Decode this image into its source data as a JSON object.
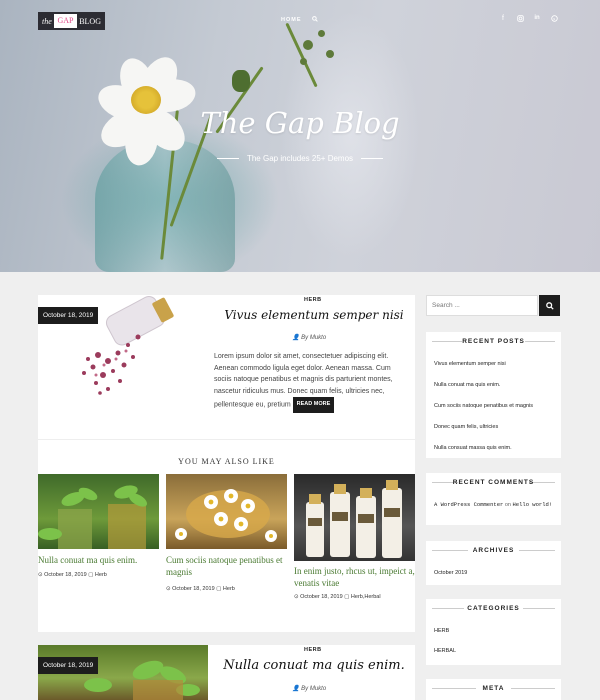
{
  "header": {
    "logo": {
      "the": "the",
      "gap": "GAP",
      "blog": "BLOG"
    },
    "nav": {
      "home": "HOME",
      "search_icon": "search-icon"
    },
    "social_icons": [
      "facebook-icon",
      "instagram-icon",
      "linkedin-icon",
      "skype-icon"
    ],
    "hero_title": "The Gap Blog",
    "hero_subtitle": "The Gap includes 25+ Demos"
  },
  "featured_post": {
    "date": "October 18, 2019",
    "category": "HERB",
    "title": "Vivus elementum semper nisi",
    "author": "By Mukto",
    "excerpt": "Lorem ipsum dolor sit amet, consectetuer adipiscing elit. Aenean commodo ligula eget dolor. Aenean massa. Cum sociis natoque penatibus et magnis dis parturient montes, nascetur ridiculus mus. Donec quam felis, ultricies nec, pellentesque eu, pretium",
    "read_more": "READ MORE"
  },
  "related": {
    "heading": "YOU MAY ALSO LIKE",
    "items": [
      {
        "title": "Nulla conuat ma quis enim.",
        "date": "October 18, 2019",
        "category": "Herb"
      },
      {
        "title": "Cum sociis natoque penatibus et magnis",
        "date": "October 18, 2019",
        "category": "Herb"
      },
      {
        "title": "In enim justo, rhcus ut, impeict a, venatis vitae",
        "date": "October 18, 2019",
        "category": "Herb,Herbal"
      }
    ]
  },
  "second_post": {
    "date": "October 18, 2019",
    "category": "HERB",
    "title": "Nulla conuat ma quis enim.",
    "author": "By Mukto"
  },
  "sidebar": {
    "search_placeholder": "Search ...",
    "recent_posts": {
      "title": "RECENT POSTS",
      "items": [
        "Vivus elementum semper nisi",
        "Nulla conuat ma quis enim.",
        "Cum sociis natoque penatibus et magnis",
        "Donec quam felis, ultricies",
        "Nulla consuat massa quis enim."
      ]
    },
    "recent_comments": {
      "title": "RECENT COMMENTS",
      "author": "A WordPress Commenter",
      "on": "on",
      "post": "Hello world!"
    },
    "archives": {
      "title": "ARCHIVES",
      "items": [
        "October 2019"
      ]
    },
    "categories": {
      "title": "CATEGORIES",
      "items": [
        "HERB",
        "HERBAL"
      ]
    },
    "meta": {
      "title": "META"
    }
  }
}
